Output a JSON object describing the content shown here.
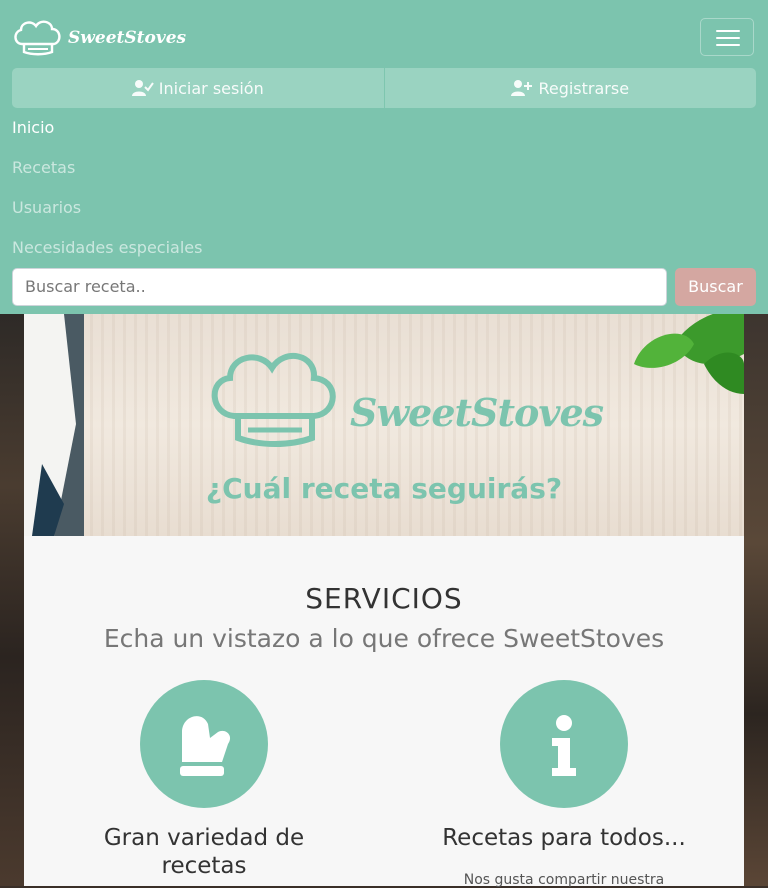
{
  "brand": {
    "name": "SweetStoves"
  },
  "auth": {
    "login_label": "Iniciar sesión",
    "register_label": "Registrarse"
  },
  "nav": {
    "items": [
      "Inicio",
      "Recetas",
      "Usuarios",
      "Necesidades especiales"
    ],
    "active": "Inicio"
  },
  "search": {
    "placeholder": "Buscar receta..",
    "button_label": "Buscar"
  },
  "hero": {
    "brand": "SweetStoves",
    "tagline": "¿Cuál receta seguirás?"
  },
  "services": {
    "title": "SERVICIOS",
    "subtitle": "Echa un vistazo a lo que ofrece SweetStoves",
    "items": [
      {
        "icon": "oven-mitt-icon",
        "title": "Gran variedad de recetas",
        "text": ""
      },
      {
        "icon": "info-icon",
        "title": "Recetas para todos...",
        "text": "Nos gusta compartir nuestra"
      }
    ]
  },
  "colors": {
    "primary": "#7cc4ae",
    "search_button": "#d4a7a1",
    "background": "#f7f7f7"
  }
}
